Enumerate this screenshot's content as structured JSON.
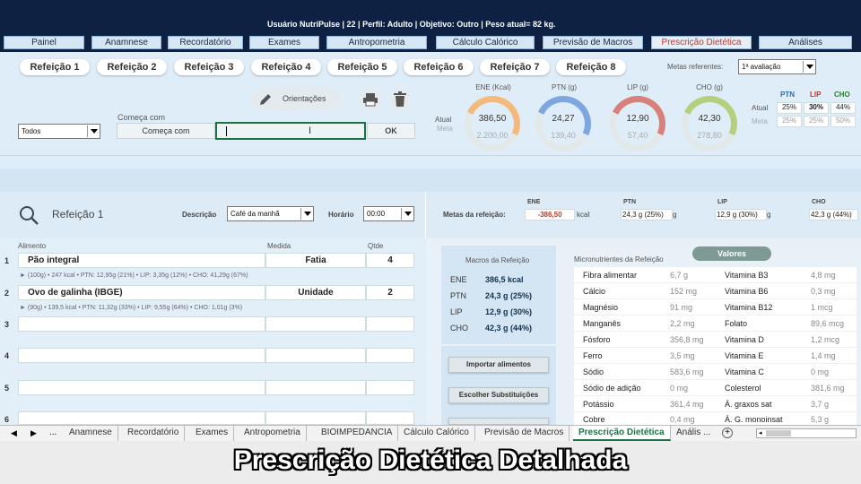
{
  "header": {
    "user_info": "Usuário NutriPulse  |  22  |  Perfil: Adulto  |  Objetivo: Outro  |  Peso atual= 82 kg."
  },
  "nav": [
    "Painel",
    "Anamnese",
    "Recordatório",
    "Exames",
    "Antropometria",
    "Cálculo Calórico",
    "Previsão de Macros",
    "Prescrição Dietética",
    "Análises"
  ],
  "meals_tabs": [
    "Refeição 1",
    "Refeição 2",
    "Refeição 3",
    "Refeição 4",
    "Refeição 5",
    "Refeição 6",
    "Refeição 7",
    "Refeição 8"
  ],
  "metas_ref": {
    "label": "Metas referentes:",
    "value": "1ª avaliação"
  },
  "search": {
    "filter_value": "Todos",
    "starts_with_label": "Começa com",
    "starts_with_value": "Começa com",
    "input_value": "",
    "ok_label": "OK",
    "orientacoes_label": "Orientações"
  },
  "gauges": {
    "row_atual": "Atual",
    "row_meta": "Meta",
    "items": [
      {
        "title": "ENE (Kcal)",
        "atual": "386,50",
        "meta": "2.200,00",
        "color": "#f5b97b"
      },
      {
        "title": "PTN (g)",
        "atual": "24,27",
        "meta": "139,40",
        "color": "#7ea6e0"
      },
      {
        "title": "LIP (g)",
        "atual": "12,90",
        "meta": "57,40",
        "color": "#d9807b"
      },
      {
        "title": "CHO (g)",
        "atual": "42,30",
        "meta": "278,80",
        "color": "#b5cf7f"
      }
    ]
  },
  "pct_table": {
    "headers": [
      "PTN",
      "LIP",
      "CHO"
    ],
    "header_colors": [
      "#2b6cb0",
      "#c0392b",
      "#2e7d32"
    ],
    "atual_label": "Atual",
    "meta_label": "Meta",
    "atual": [
      "25%",
      "30%",
      "44%"
    ],
    "meta": [
      "25%",
      "25%",
      "50%"
    ]
  },
  "meal": {
    "title": "Refeição 1",
    "descricao_label": "Descrição",
    "descricao_value": "Café da manhã",
    "horario_label": "Horário",
    "horario_value": "00:00",
    "metas_label": "Metas da refeição:",
    "metas_cols": [
      {
        "name": "ENE",
        "value": "-386,50",
        "unit": "kcal"
      },
      {
        "name": "PTN",
        "value": "24,3 g  (25%)",
        "unit": "g"
      },
      {
        "name": "LIP",
        "value": "12,9 g  (30%)",
        "unit": "g"
      },
      {
        "name": "CHO",
        "value": "42,3 g  (44%)",
        "unit": ""
      }
    ]
  },
  "food_table": {
    "headers": [
      "Alimento",
      "Medida",
      "Qtde"
    ],
    "rows": [
      {
        "num": "1",
        "food": "Pão integral",
        "measure": "Fatia",
        "qty": "4",
        "detail": "► (100g) • 247 kcal  •  PTN: 12,95g (21%)  •  LIP: 3,35g (12%)  •  CHO: 41,29g (67%)"
      },
      {
        "num": "2",
        "food": "Ovo de galinha (IBGE)",
        "measure": "Unidade",
        "qty": "2",
        "detail": "► (90g) • 139,5 kcal  •  PTN: 11,32g (33%)  •  LIP: 9,55g (64%)  •  CHO: 1,01g (3%)"
      },
      {
        "num": "3",
        "food": "",
        "measure": "",
        "qty": "",
        "detail": ""
      },
      {
        "num": "4",
        "food": "",
        "measure": "",
        "qty": "",
        "detail": ""
      },
      {
        "num": "5",
        "food": "",
        "measure": "",
        "qty": "",
        "detail": ""
      },
      {
        "num": "6",
        "food": "",
        "measure": "",
        "qty": "",
        "detail": ""
      }
    ]
  },
  "macros": {
    "title": "Macros da Refeição",
    "rows": [
      {
        "k": "ENE",
        "v": "386,5 kcal"
      },
      {
        "k": "PTN",
        "v": "24,3 g  (25%)"
      },
      {
        "k": "LIP",
        "v": "12,9 g  (30%)"
      },
      {
        "k": "CHO",
        "v": "42,3 g  (44%)"
      }
    ],
    "btn_import": "Importar alimentos",
    "btn_subst": "Escolher Substituições"
  },
  "micro": {
    "title": "Micronutrientes da Refeição",
    "valores_btn": "Valores",
    "rows": [
      [
        "Fibra alimentar",
        "6,7 g",
        "Vitamina B3",
        "4,8 mg"
      ],
      [
        "Cálcio",
        "152 mg",
        "Vitamina B6",
        "0,3 mg"
      ],
      [
        "Magnésio",
        "91 mg",
        "Vitamina B12",
        "1 mcg"
      ],
      [
        "Manganês",
        "2,2 mg",
        "Folato",
        "89,6 mcg"
      ],
      [
        "Fósforo",
        "356,8 mg",
        "Vitamina D",
        "1,2 mcg"
      ],
      [
        "Ferro",
        "3,5 mg",
        "Vitamina E",
        "1,4 mg"
      ],
      [
        "Sódio",
        "583,6 mg",
        "Vitamina C",
        "0 mg"
      ],
      [
        "Sódio de adição",
        "0 mg",
        "Colesterol",
        "381,6 mg"
      ],
      [
        "Potássio",
        "361,4 mg",
        "Á. graxos sat",
        "3,7 g"
      ],
      [
        "Cobre",
        "0,4 mg",
        "Á. G. monoinsat",
        "5,3 g"
      ]
    ]
  },
  "sheet_tabs": {
    "ellipsis": "...",
    "items": [
      "Anamnese",
      "Recordatório",
      "Exames",
      "Antropometria",
      "BIOIMPEDANCIA",
      "Cálculo Calórico",
      "Previsão de Macros",
      "Prescrição Dietética",
      "Anális ..."
    ]
  },
  "caption": "Prescrição Dietética Detalhada"
}
